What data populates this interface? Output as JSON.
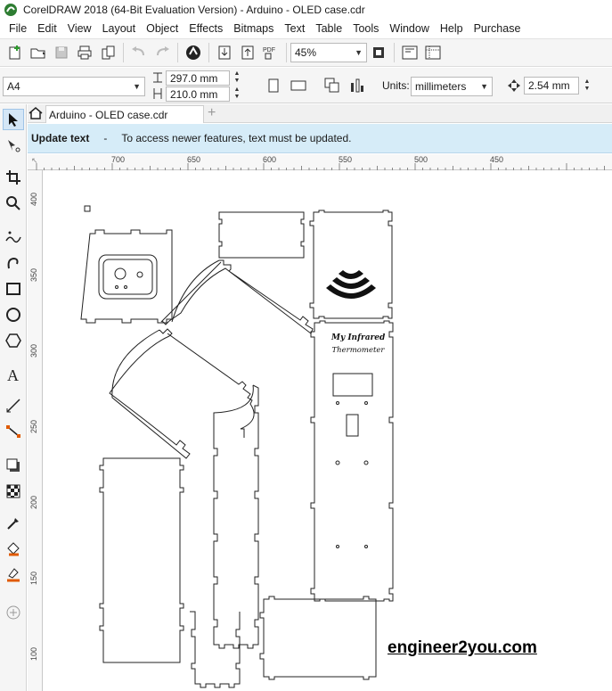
{
  "window": {
    "title": "CorelDRAW 2018 (64-Bit Evaluation Version) - Arduino - OLED case.cdr"
  },
  "menu": [
    "File",
    "Edit",
    "View",
    "Layout",
    "Object",
    "Effects",
    "Bitmaps",
    "Text",
    "Table",
    "Tools",
    "Window",
    "Help",
    "Purchase"
  ],
  "toolbar": {
    "zoom": "45%",
    "icons": [
      "new-document-icon",
      "open-icon",
      "save-icon",
      "print-icon",
      "cut-icon",
      "undo-icon",
      "redo-icon",
      "corel-connect-icon",
      "import-icon",
      "export-icon",
      "pdf-icon",
      "zoom-fit-icon",
      "snap-icon",
      "show-rulers-icon"
    ]
  },
  "property_bar": {
    "page_size": "A4",
    "width": "297.0 mm",
    "height": "210.0 mm",
    "units_label": "Units:",
    "units": "millimeters",
    "nudge": "2.54 mm"
  },
  "document": {
    "tab_label": "Arduino - OLED case.cdr"
  },
  "notification": {
    "title": "Update text",
    "separator": "-",
    "message": "To access newer features, text must be updated."
  },
  "rulers": {
    "horizontal": [
      "700",
      "650",
      "600",
      "550",
      "500",
      "450"
    ],
    "vertical": [
      "400",
      "350",
      "300",
      "250",
      "200",
      "150",
      "100"
    ]
  },
  "artwork": {
    "label_line1": "My Infrared",
    "label_line2": "Thermometer",
    "watermark": "engineer2you.com"
  },
  "colors": {
    "notification_bg": "#d6ecf8",
    "toolbar_bg": "#f5f5f5",
    "outline": "#222222"
  }
}
